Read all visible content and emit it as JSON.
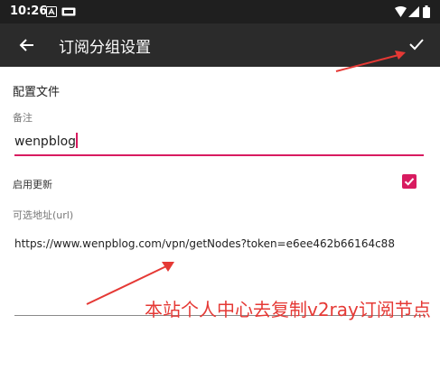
{
  "status_bar": {
    "time": "10:26"
  },
  "app_bar": {
    "title": "订阅分组设置"
  },
  "form": {
    "section_header": "配置文件",
    "remarks": {
      "label": "备注",
      "value": "wenpblog"
    },
    "enable_update": {
      "label": "启用更新",
      "checked": true
    },
    "url": {
      "label": "可选地址(url)",
      "value": "https://www.wenpblog.com/vpn/getNodes?token=e6ee462b66164c88"
    }
  },
  "annotation": {
    "text": "本站个人中心去复制v2ray订阅节点"
  },
  "colors": {
    "accent": "#d81b60",
    "annotation": "#e53935",
    "app_bar": "#2b2b2b",
    "status_bar": "#1f1f1f"
  }
}
